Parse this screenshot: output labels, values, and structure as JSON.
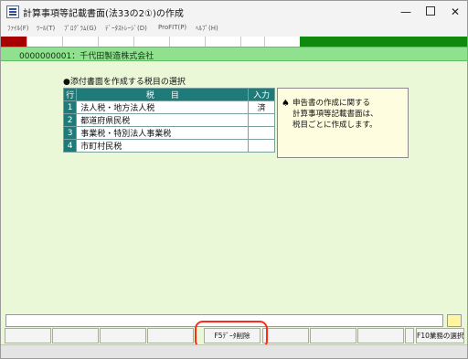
{
  "window": {
    "title": "計算事項等記載書面(法33の2①)の作成",
    "minimize_glyph": "—",
    "close_glyph": "✕"
  },
  "menu": {
    "items": [
      {
        "label": "ﾌｧｲﾙ(F)"
      },
      {
        "label": "ﾂｰﾙ(T)"
      },
      {
        "label": "ﾌﾟﾛｸﾞﾗﾑ(G)"
      },
      {
        "label": "ﾃﾞｰﾀｽﾄﾚｰｼﾞ(D)"
      },
      {
        "label": "ProFIT(P)"
      },
      {
        "label": "ﾍﾙﾌﾟ(H)"
      }
    ]
  },
  "company": {
    "label": "0000000001：千代田製造株式会社"
  },
  "section": {
    "title": "●添付書面を作成する税目の選択"
  },
  "tax_table": {
    "headers": {
      "row": "行",
      "item": "税　　目",
      "input": "入力"
    },
    "rows": [
      {
        "num": "1",
        "name": "法人税・地方法人税",
        "status": "済"
      },
      {
        "num": "2",
        "name": "都道府県民税",
        "status": ""
      },
      {
        "num": "3",
        "name": "事業税・特別法人事業税",
        "status": ""
      },
      {
        "num": "4",
        "name": "市町村民税",
        "status": ""
      }
    ]
  },
  "info_box": {
    "icon": "spade-icon",
    "lines": [
      "申告書の作成に関する",
      "計算事項等記載書面は、",
      "税目ごとに作成します。"
    ]
  },
  "function_keys": [
    {
      "label": ""
    },
    {
      "label": ""
    },
    {
      "label": ""
    },
    {
      "label": ""
    },
    {
      "label": "F5ﾃﾞｰﾀ削除"
    },
    {
      "label": ""
    },
    {
      "label": ""
    },
    {
      "label": ""
    },
    {
      "label": ""
    },
    {
      "label": "F10業務の選択"
    }
  ],
  "colors": {
    "accent_red": "#a60000",
    "accent_green": "#0f8a0f",
    "table_header": "#1f7a7a",
    "client_bg": "#eaf8d8",
    "highlight": "#ff2a1a"
  }
}
